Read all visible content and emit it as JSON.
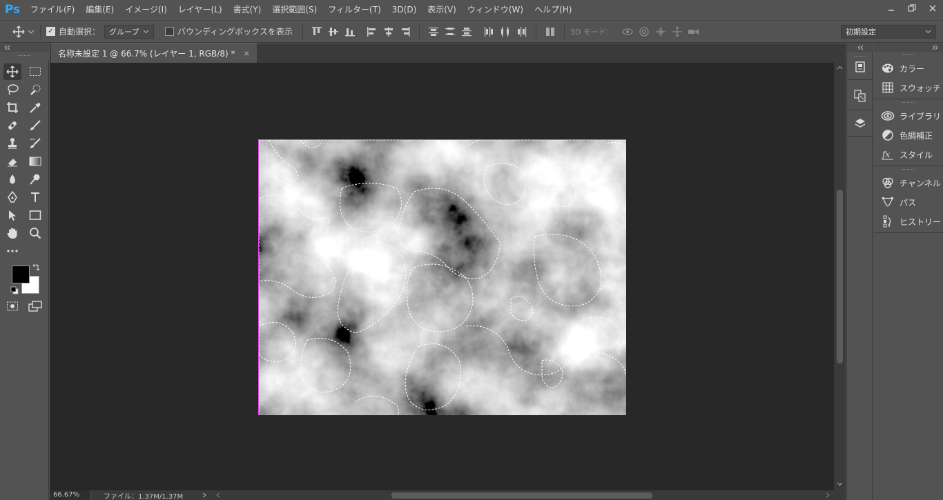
{
  "app": {
    "logo": "Ps"
  },
  "menu": [
    "ファイル(F)",
    "編集(E)",
    "イメージ(I)",
    "レイヤー(L)",
    "書式(Y)",
    "選択範囲(S)",
    "フィルター(T)",
    "3D(D)",
    "表示(V)",
    "ウィンドウ(W)",
    "ヘルプ(H)"
  ],
  "options": {
    "auto_select_label": "自動選択：",
    "auto_select_value": "グループ",
    "bounding_box_label": "バウンディングボックスを表示",
    "mode_3d_label": "3D モード：",
    "workspace": "初期設定"
  },
  "document": {
    "tab_title": "名称未設定 1 @ 66.7% (レイヤー 1, RGB/8) *",
    "close": "×"
  },
  "status": {
    "zoom": "66.67%",
    "file_info": "ファイル：1.37M/1.37M"
  },
  "panels": [
    {
      "label": "カラー",
      "icon": "palette-icon"
    },
    {
      "label": "スウォッチ",
      "icon": "grid-icon"
    },
    {
      "label": "ライブラリ",
      "icon": "cloud-icon"
    },
    {
      "label": "色調補正",
      "icon": "adjust-icon"
    },
    {
      "label": "スタイル",
      "icon": "fx-icon"
    },
    {
      "label": "チャンネル",
      "icon": "channels-icon"
    },
    {
      "label": "パス",
      "icon": "path-icon"
    },
    {
      "label": "ヒストリー",
      "icon": "history-icon"
    }
  ],
  "colors": {
    "foreground": "#000000",
    "background": "#ffffff",
    "selection_edge": "#e24be8"
  }
}
